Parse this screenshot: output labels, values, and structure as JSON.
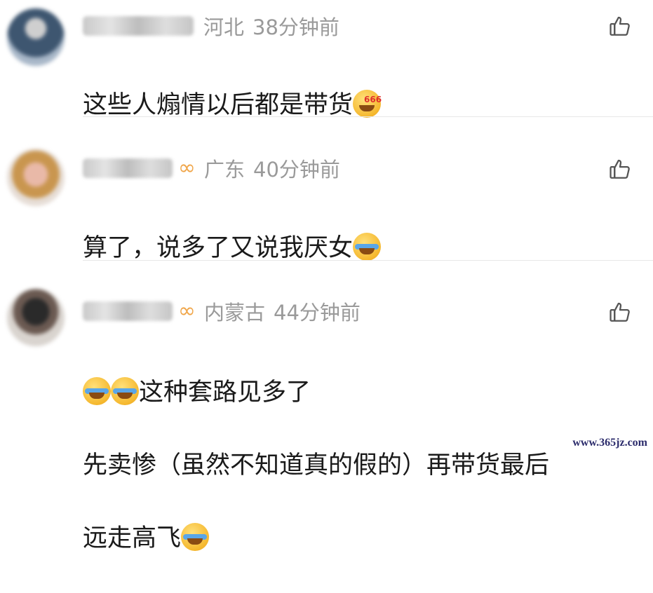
{
  "comments": [
    {
      "location": "河北",
      "time": "38分钟前",
      "text": "这些人煽情以后都是带货",
      "emoji": "666-smirk-emoji"
    },
    {
      "location": "广东",
      "time": "40分钟前",
      "text": "算了，说多了又说我厌女",
      "emoji": "facepalm-emoji"
    },
    {
      "location": "内蒙古",
      "time": "44分钟前",
      "text_line1": "这种套路见多了",
      "text_line2": "先卖惨（虽然不知道真的假的）再带货最后",
      "text_line3": "远走高飞",
      "emoji": "laugh-cry-emoji"
    }
  ],
  "watermark": "www.365jz.com",
  "colors": {
    "meta_gray": "#9a9a9a",
    "vip_orange": "#f0a64a",
    "divider": "#e8e8e8"
  }
}
